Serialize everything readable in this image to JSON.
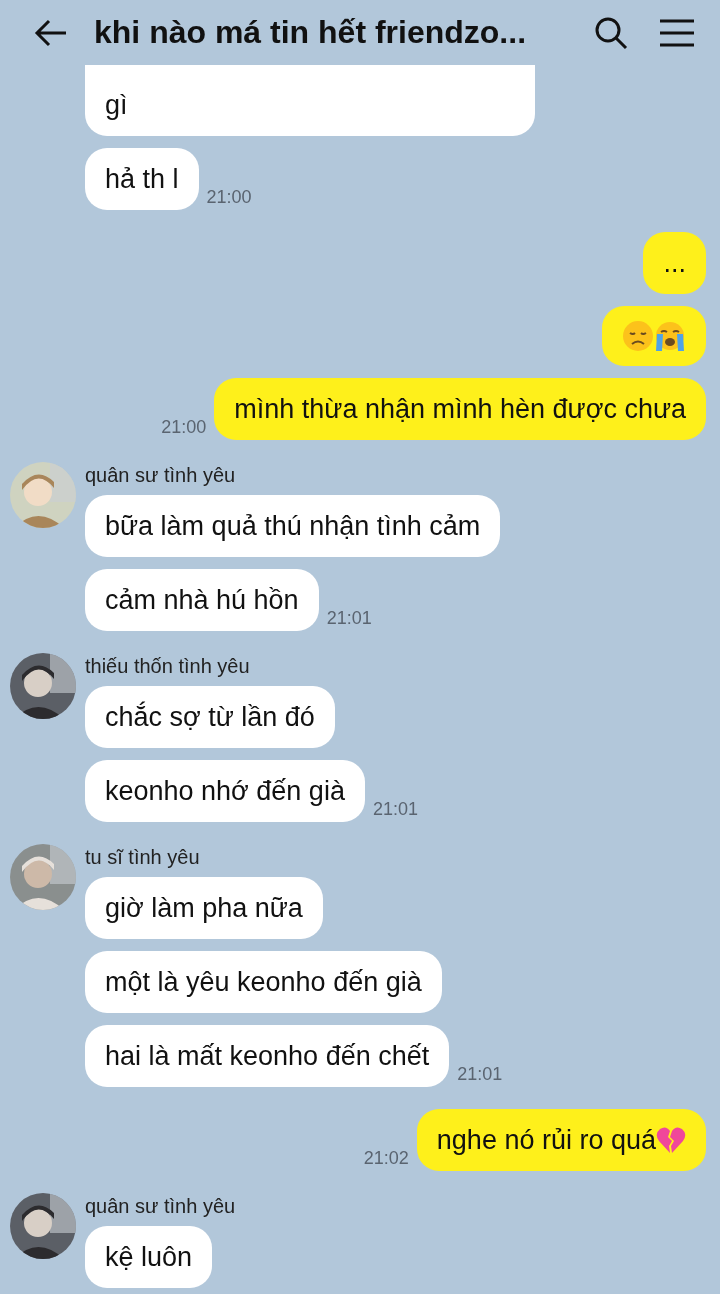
{
  "header": {
    "title": "khi nào má tin hết friendzo..."
  },
  "groups": [
    {
      "mine": false,
      "messages": [
        {
          "kind": "text-cut",
          "text": "gì"
        },
        {
          "kind": "text",
          "text": "hả th l"
        }
      ],
      "time": "21:00"
    },
    {
      "mine": true,
      "messages": [
        {
          "kind": "text",
          "text": "..."
        },
        {
          "kind": "sad-crying"
        },
        {
          "kind": "text",
          "text": "mình thừa nhận mình hèn được chưa"
        }
      ],
      "time": "21:00"
    },
    {
      "mine": false,
      "sender": "quân sư tình yêu",
      "messages": [
        {
          "kind": "text",
          "text": "bữa làm quả thú nhận tình cảm"
        },
        {
          "kind": "text",
          "text": "cảm nhà hú hồn"
        }
      ],
      "time": "21:01"
    },
    {
      "mine": false,
      "sender": "thiếu thốn tình yêu",
      "messages": [
        {
          "kind": "text",
          "text": "chắc sợ từ lần đó"
        },
        {
          "kind": "text",
          "text": "keonho nhớ đến già"
        }
      ],
      "time": "21:01"
    },
    {
      "mine": false,
      "sender": "tu sĩ tình yêu",
      "messages": [
        {
          "kind": "text",
          "text": "giờ làm pha nữa"
        },
        {
          "kind": "text",
          "text": "một là yêu keonho đến già"
        },
        {
          "kind": "text",
          "text": "hai là mất keonho đến chết"
        }
      ],
      "time": "21:01"
    },
    {
      "mine": true,
      "messages": [
        {
          "kind": "text-heart",
          "text": "nghe nó rủi ro quá"
        }
      ],
      "time": "21:02"
    },
    {
      "mine": false,
      "sender": "quân sư tình yêu",
      "messages": [
        {
          "kind": "text",
          "text": "kệ luôn"
        }
      ]
    }
  ]
}
